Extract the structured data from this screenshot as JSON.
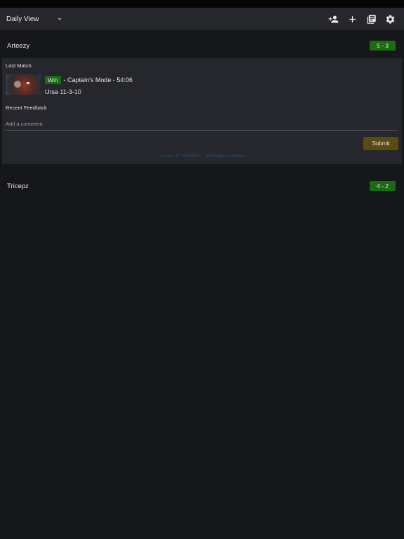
{
  "toolbar": {
    "view_label": "Daily View",
    "actions": [
      {
        "icon": "person-add-icon",
        "label": "Add player"
      },
      {
        "icon": "plus-icon",
        "label": "Add"
      },
      {
        "icon": "library-books-icon",
        "label": "Library"
      },
      {
        "icon": "gear-icon",
        "label": "Settings"
      }
    ]
  },
  "players": [
    {
      "name": "Arteezy",
      "record": "5 - 3",
      "expanded": true,
      "last_match": {
        "section_label": "Last Match",
        "result": "Win",
        "description": "- Captain's Mode - 54:06",
        "hero_line": "Ursa 11-3-10"
      },
      "feedback": {
        "section_label": "Recent Feedback",
        "comment_placeholder": "Add a comment",
        "comment_value": "",
        "submit_label": "Submit"
      },
      "account_line": "Account ID: 86745912 - Notifications Enabled"
    },
    {
      "name": "Tricepz",
      "record": "4 - 2",
      "expanded": false
    }
  ],
  "colors": {
    "background": "#16171b",
    "surface": "#26272c",
    "win_green": "#1a6b12",
    "submit_gold": "#5b4a12",
    "account_text": "#2b4f6b"
  }
}
